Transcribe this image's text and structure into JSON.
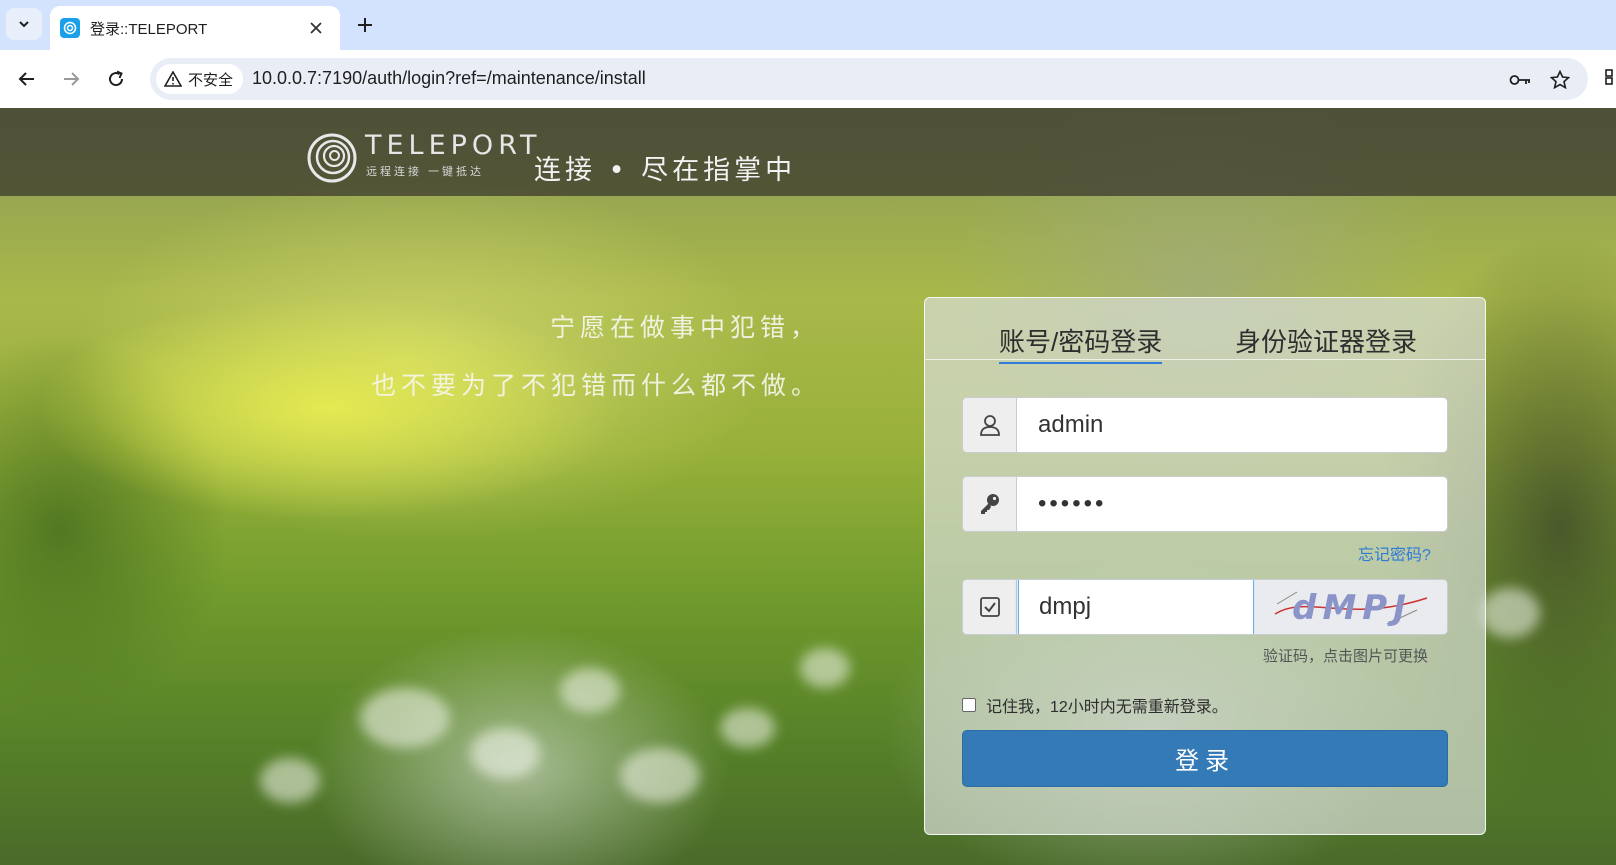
{
  "browser": {
    "tab_title": "登录::TELEPORT",
    "security_label": "不安全",
    "url": "10.0.0.7:7190/auth/login?ref=/maintenance/install",
    "icons": {
      "tab_menu": "chevron-down-icon",
      "close": "close-icon",
      "new_tab": "plus-icon",
      "back": "back-arrow-icon",
      "forward": "forward-arrow-icon",
      "reload": "reload-icon",
      "warning": "warning-icon",
      "password": "key-icon",
      "bookmark": "star-icon"
    }
  },
  "header": {
    "logo_word": "TELEPORT",
    "logo_sub": "远程连接 一键抵达",
    "slogan": "连接 • 尽在指掌中"
  },
  "quote": {
    "line1": "宁愿在做事中犯错，",
    "line2": "也不要为了不犯错而什么都不做。"
  },
  "login": {
    "tabs": [
      {
        "label": "账号/密码登录",
        "active": true
      },
      {
        "label": "身份验证器登录",
        "active": false
      }
    ],
    "username": "admin",
    "password_mask": "••••••",
    "forgot_password": "忘记密码?",
    "captcha_value": "dmpj",
    "captcha_image_text": "dMPJ",
    "captcha_hint": "验证码，点击图片可更换",
    "remember_label": "记住我，12小时内无需重新登录。",
    "remember_checked": false,
    "submit_label": "登录"
  },
  "colors": {
    "accent": "#337ab7",
    "link": "#2f7bd6",
    "tabbar": "#d3e3fd"
  }
}
